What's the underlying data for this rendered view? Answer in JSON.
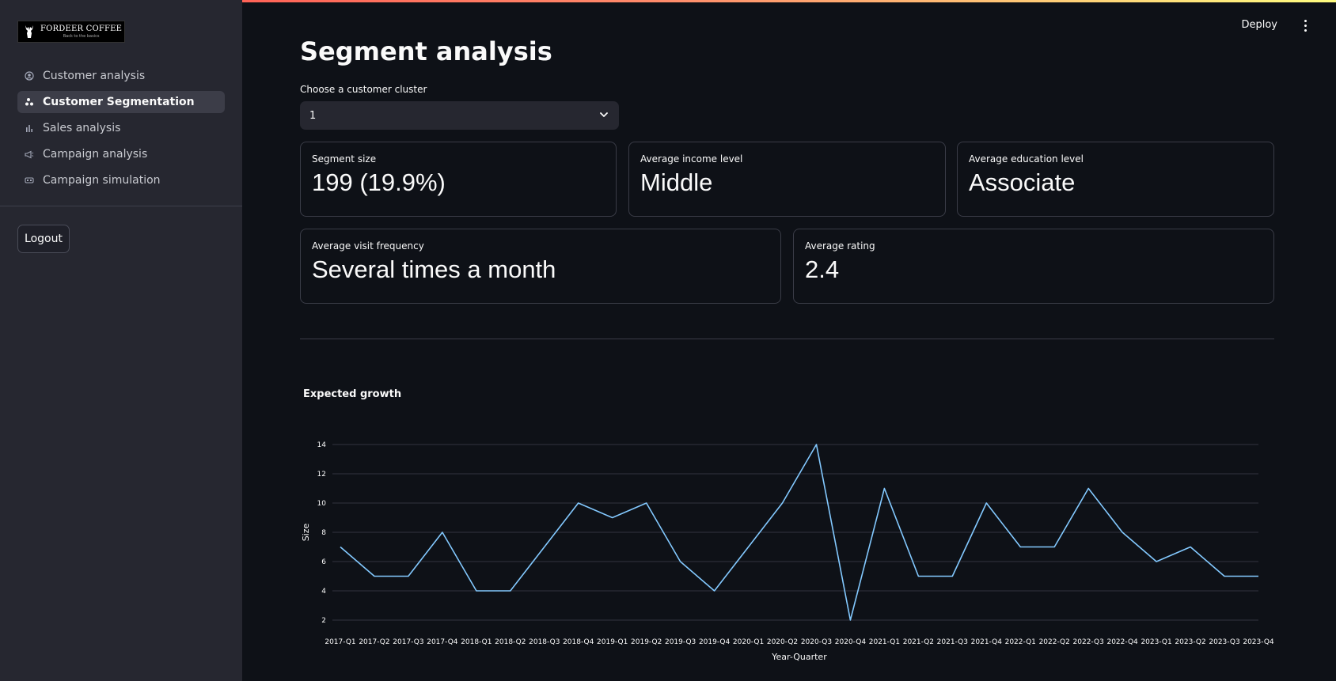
{
  "sidebar": {
    "logo": {
      "name": "FORDEER COFFEE",
      "tagline": "Back to the basics"
    },
    "items": [
      {
        "label": "Customer analysis",
        "icon": "person-circle-icon",
        "active": false
      },
      {
        "label": "Customer Segmentation",
        "icon": "segments-icon",
        "active": true
      },
      {
        "label": "Sales analysis",
        "icon": "bar-chart-icon",
        "active": false
      },
      {
        "label": "Campaign analysis",
        "icon": "megaphone-icon",
        "active": false
      },
      {
        "label": "Campaign simulation",
        "icon": "simulation-icon",
        "active": false
      }
    ],
    "logout_label": "Logout"
  },
  "header": {
    "deploy_label": "Deploy",
    "menu_icon": "more-vertical-icon"
  },
  "main": {
    "title": "Segment analysis",
    "cluster_select": {
      "label": "Choose a customer cluster",
      "value": "1"
    },
    "metrics": [
      {
        "label": "Segment size",
        "value": "199 (19.9%)"
      },
      {
        "label": "Average income level",
        "value": "Middle"
      },
      {
        "label": "Average education level",
        "value": "Associate"
      },
      {
        "label": "Average visit frequency",
        "value": "Several times a month"
      },
      {
        "label": "Average rating",
        "value": "2.4"
      }
    ]
  },
  "colors": {
    "accent": "#ff4b4b",
    "line": "#83c9ff",
    "background": "#0e1117",
    "sidebar": "#262730"
  },
  "chart_data": {
    "type": "line",
    "title": "Expected growth",
    "xlabel": "Year-Quarter",
    "ylabel": "Size",
    "ylim": [
      2,
      14
    ],
    "yticks": [
      2,
      4,
      6,
      8,
      10,
      12,
      14
    ],
    "grid": true,
    "categories": [
      "2017-Q1",
      "2017-Q2",
      "2017-Q3",
      "2017-Q4",
      "2018-Q1",
      "2018-Q2",
      "2018-Q3",
      "2018-Q4",
      "2019-Q1",
      "2019-Q2",
      "2019-Q3",
      "2019-Q4",
      "2020-Q1",
      "2020-Q2",
      "2020-Q3",
      "2020-Q4",
      "2021-Q1",
      "2021-Q2",
      "2021-Q3",
      "2021-Q4",
      "2022-Q1",
      "2022-Q2",
      "2022-Q3",
      "2022-Q4",
      "2023-Q1",
      "2023-Q2",
      "2023-Q3",
      "2023-Q4"
    ],
    "values": [
      7,
      5,
      5,
      8,
      4,
      4,
      7,
      10,
      9,
      10,
      6,
      4,
      7,
      10,
      14,
      2,
      11,
      5,
      5,
      10,
      7,
      7,
      11,
      8,
      6,
      7,
      5,
      5
    ]
  }
}
